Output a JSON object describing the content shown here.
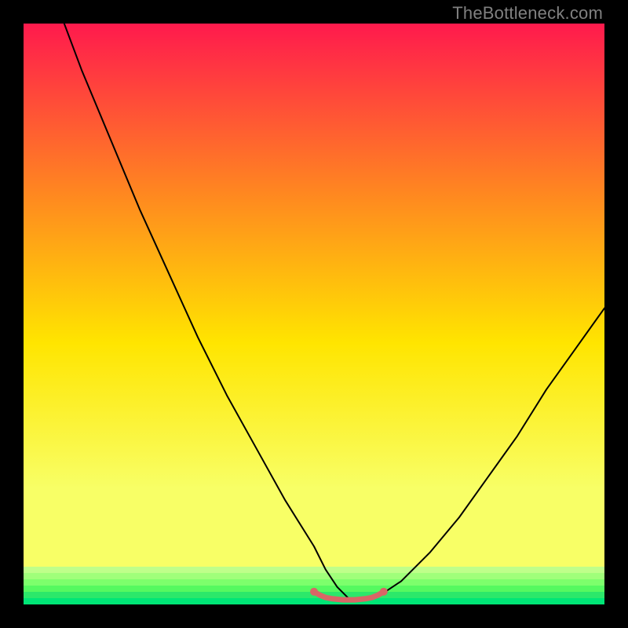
{
  "watermark": "TheBottleneck.com",
  "chart_data": {
    "type": "line",
    "title": "",
    "xlabel": "",
    "ylabel": "",
    "xlim": [
      0,
      100
    ],
    "ylim": [
      0,
      100
    ],
    "grid": false,
    "legend": false,
    "gradient_colors": {
      "top": "#ff1a4d",
      "upper_mid": "#ff8a1f",
      "mid": "#ffe500",
      "lower_mid": "#f8ff66",
      "bottom": "#00e676"
    },
    "series": [
      {
        "name": "bottleneck-curve",
        "color": "#000000",
        "stroke_width": 2,
        "x": [
          7,
          10,
          15,
          20,
          25,
          30,
          35,
          40,
          45,
          50,
          52,
          54,
          56,
          58,
          60,
          62,
          65,
          70,
          75,
          80,
          85,
          90,
          95,
          100
        ],
        "values": [
          100,
          92,
          80,
          68,
          57,
          46,
          36,
          27,
          18,
          10,
          6,
          3,
          1,
          1,
          1,
          2,
          4,
          9,
          15,
          22,
          29,
          37,
          44,
          51
        ]
      },
      {
        "name": "valley-marker",
        "color": "#d86666",
        "stroke_width": 7,
        "x": [
          50,
          51,
          52,
          53,
          54,
          55,
          56,
          57,
          58,
          59,
          60,
          61,
          62
        ],
        "values": [
          2.2,
          1.6,
          1.2,
          1.0,
          0.9,
          0.8,
          0.8,
          0.8,
          0.9,
          1.0,
          1.2,
          1.6,
          2.2
        ]
      }
    ],
    "markers": [
      {
        "x": 50,
        "y": 2.2,
        "color": "#d86666",
        "r": 5
      },
      {
        "x": 62,
        "y": 2.2,
        "color": "#d86666",
        "r": 5
      }
    ],
    "bottom_band": {
      "from_y": 0,
      "to_y": 6.5,
      "stripe_colors": [
        "#bfff8a",
        "#a0ff7a",
        "#7dff6c",
        "#55f960",
        "#2ce86a",
        "#00e676"
      ]
    }
  }
}
